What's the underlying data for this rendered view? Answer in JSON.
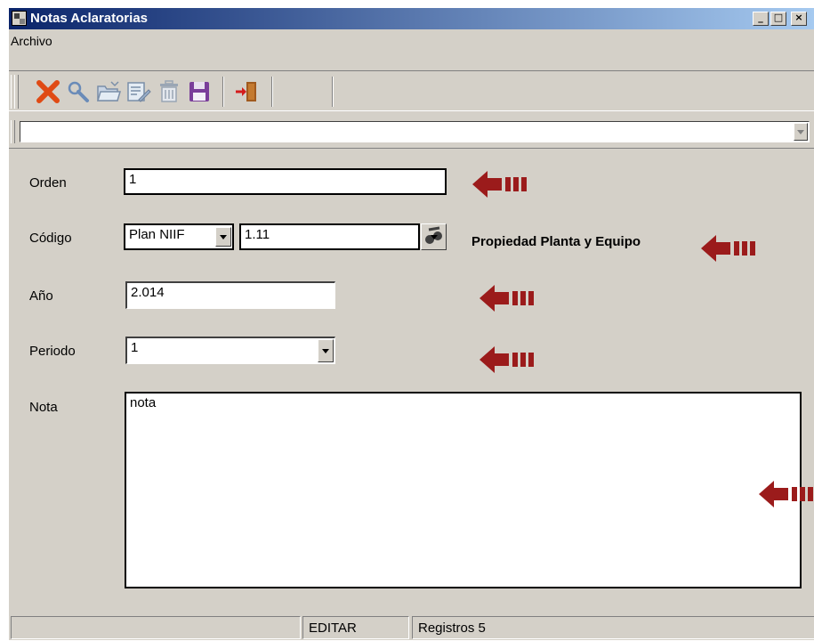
{
  "window": {
    "title": "Notas Aclaratorias",
    "controls": {
      "minimize": "_",
      "maximize": "□",
      "close": "×"
    }
  },
  "menu": {
    "file": "Archivo"
  },
  "toolbar": {
    "buttons": [
      "delete-icon",
      "search-icon",
      "open-folder-icon",
      "edit-icon",
      "trash-icon",
      "save-icon",
      "exit-icon"
    ]
  },
  "search_combo": {
    "value": ""
  },
  "form": {
    "orden": {
      "label": "Orden",
      "value": "1"
    },
    "codigo": {
      "label": "Código",
      "plan": "Plan NIIF",
      "code": "1.11",
      "description": "Propiedad Planta y Equipo"
    },
    "anio": {
      "label": "Año",
      "value": "2.014"
    },
    "periodo": {
      "label": "Periodo",
      "value": "1"
    },
    "nota": {
      "label": "Nota",
      "value": "nota"
    }
  },
  "annotation_arrow_color": "#9b1b1b",
  "status": {
    "panel1": "",
    "mode": "EDITAR",
    "records": "Registros 5"
  }
}
